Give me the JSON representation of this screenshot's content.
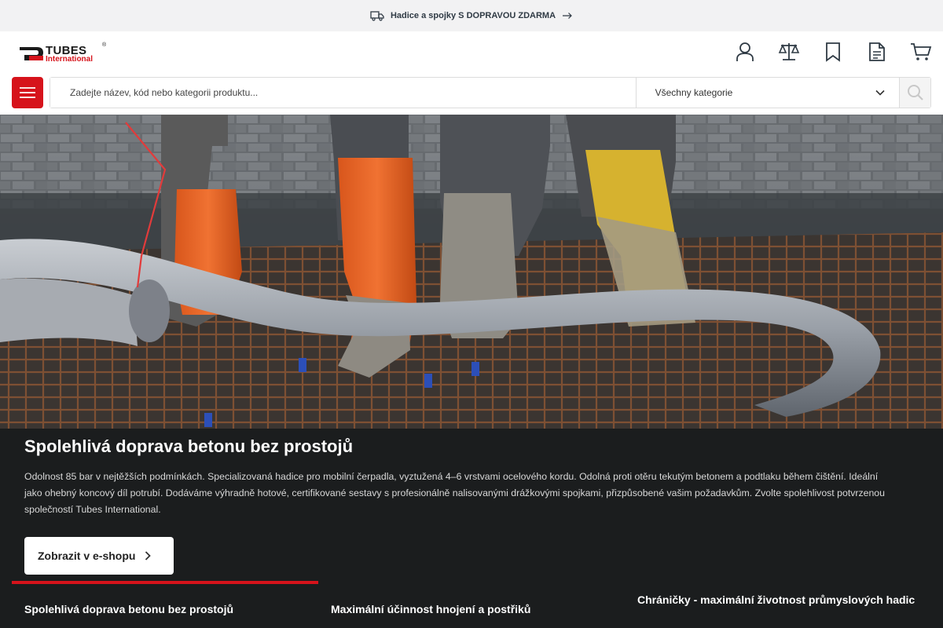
{
  "promo": {
    "text": "Hadice a spojky S DOPRAVOU ZDARMA",
    "truck_icon": "free-delivery-truck-icon",
    "arrow_icon": "arrow-right-icon"
  },
  "header": {
    "logo": {
      "brand": "TUBES",
      "sub": "International",
      "reg": "®"
    },
    "icons": [
      "user-icon",
      "compare-scale-icon",
      "bookmark-icon",
      "document-icon",
      "cart-icon"
    ]
  },
  "search": {
    "placeholder": "Zadejte název, kód nebo kategorii produktu...",
    "category": "Všechny kategorie"
  },
  "hero": {
    "title": "Spolehlivá doprava betonu bez prostojů",
    "description": "Odolnost 85 bar v nejtěžších podmínkách. Specializovaná hadice pro mobilní čerpadla, vyztužená 4–6 vrstvami ocelového kordu. Odolná proti otěru tekutým betonem a podtlaku během čištění. Ideální jako ohebný koncový díl potrubí. Dodáváme výhradně hotové, certifikované sestavy s profesionálně nalisovanými drážkovými spojkami, přizpůsobené vašim požadavkům. Zvolte spolehlivost potvrzenou společností Tubes International.",
    "button": "Zobrazit v e-shopu"
  },
  "slides": [
    "Spolehlivá doprava betonu bez prostojů",
    "Maximální účinnost hnojení a postřiků",
    "Chráničky - maximální životnost průmyslových hadic"
  ],
  "colors": {
    "accent": "#d6131b",
    "dark_bg": "#1b1d1e",
    "promo_bg": "#f2f2f3"
  }
}
